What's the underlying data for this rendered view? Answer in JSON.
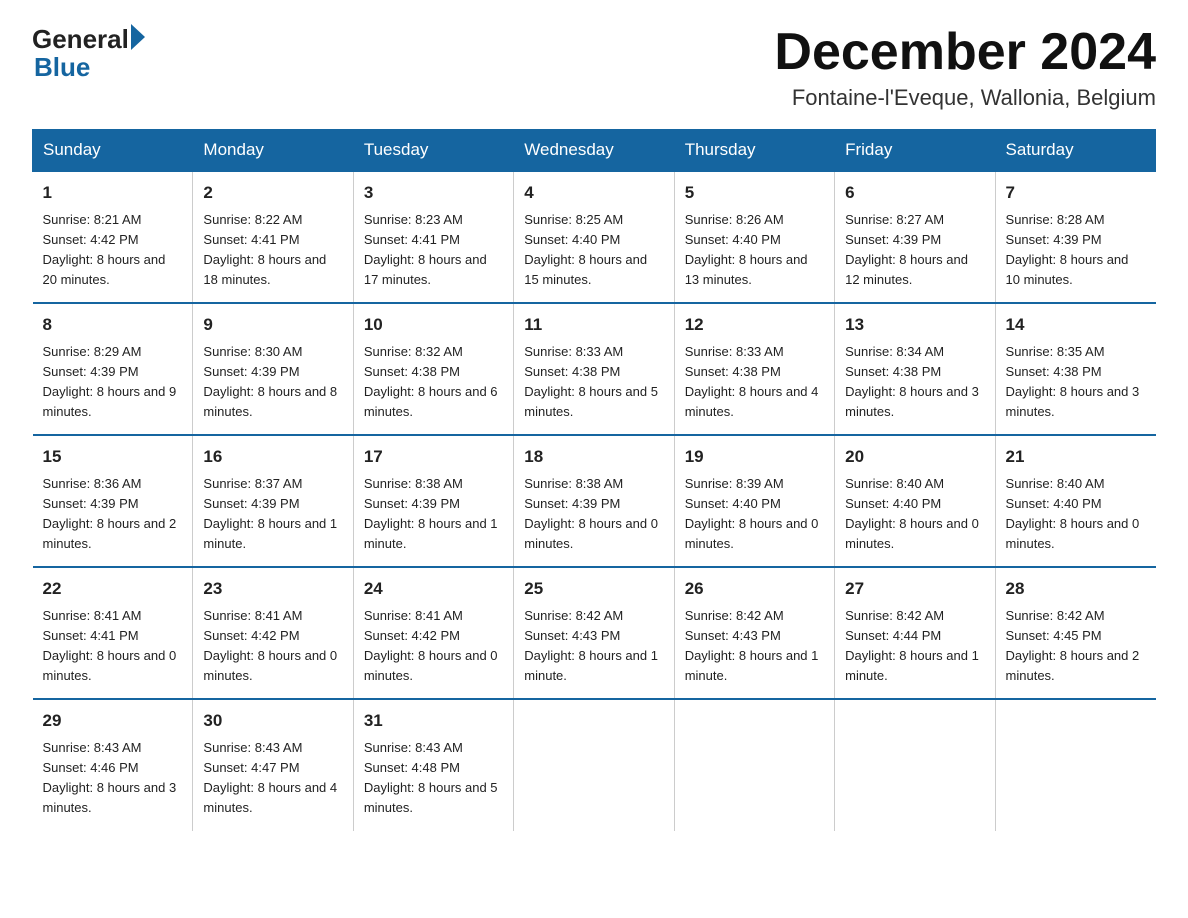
{
  "logo": {
    "general": "General",
    "blue": "Blue"
  },
  "title": "December 2024",
  "location": "Fontaine-l'Eveque, Wallonia, Belgium",
  "weekdays": [
    "Sunday",
    "Monday",
    "Tuesday",
    "Wednesday",
    "Thursday",
    "Friday",
    "Saturday"
  ],
  "weeks": [
    [
      {
        "day": "1",
        "sunrise": "8:21 AM",
        "sunset": "4:42 PM",
        "daylight": "8 hours and 20 minutes."
      },
      {
        "day": "2",
        "sunrise": "8:22 AM",
        "sunset": "4:41 PM",
        "daylight": "8 hours and 18 minutes."
      },
      {
        "day": "3",
        "sunrise": "8:23 AM",
        "sunset": "4:41 PM",
        "daylight": "8 hours and 17 minutes."
      },
      {
        "day": "4",
        "sunrise": "8:25 AM",
        "sunset": "4:40 PM",
        "daylight": "8 hours and 15 minutes."
      },
      {
        "day": "5",
        "sunrise": "8:26 AM",
        "sunset": "4:40 PM",
        "daylight": "8 hours and 13 minutes."
      },
      {
        "day": "6",
        "sunrise": "8:27 AM",
        "sunset": "4:39 PM",
        "daylight": "8 hours and 12 minutes."
      },
      {
        "day": "7",
        "sunrise": "8:28 AM",
        "sunset": "4:39 PM",
        "daylight": "8 hours and 10 minutes."
      }
    ],
    [
      {
        "day": "8",
        "sunrise": "8:29 AM",
        "sunset": "4:39 PM",
        "daylight": "8 hours and 9 minutes."
      },
      {
        "day": "9",
        "sunrise": "8:30 AM",
        "sunset": "4:39 PM",
        "daylight": "8 hours and 8 minutes."
      },
      {
        "day": "10",
        "sunrise": "8:32 AM",
        "sunset": "4:38 PM",
        "daylight": "8 hours and 6 minutes."
      },
      {
        "day": "11",
        "sunrise": "8:33 AM",
        "sunset": "4:38 PM",
        "daylight": "8 hours and 5 minutes."
      },
      {
        "day": "12",
        "sunrise": "8:33 AM",
        "sunset": "4:38 PM",
        "daylight": "8 hours and 4 minutes."
      },
      {
        "day": "13",
        "sunrise": "8:34 AM",
        "sunset": "4:38 PM",
        "daylight": "8 hours and 3 minutes."
      },
      {
        "day": "14",
        "sunrise": "8:35 AM",
        "sunset": "4:38 PM",
        "daylight": "8 hours and 3 minutes."
      }
    ],
    [
      {
        "day": "15",
        "sunrise": "8:36 AM",
        "sunset": "4:39 PM",
        "daylight": "8 hours and 2 minutes."
      },
      {
        "day": "16",
        "sunrise": "8:37 AM",
        "sunset": "4:39 PM",
        "daylight": "8 hours and 1 minute."
      },
      {
        "day": "17",
        "sunrise": "8:38 AM",
        "sunset": "4:39 PM",
        "daylight": "8 hours and 1 minute."
      },
      {
        "day": "18",
        "sunrise": "8:38 AM",
        "sunset": "4:39 PM",
        "daylight": "8 hours and 0 minutes."
      },
      {
        "day": "19",
        "sunrise": "8:39 AM",
        "sunset": "4:40 PM",
        "daylight": "8 hours and 0 minutes."
      },
      {
        "day": "20",
        "sunrise": "8:40 AM",
        "sunset": "4:40 PM",
        "daylight": "8 hours and 0 minutes."
      },
      {
        "day": "21",
        "sunrise": "8:40 AM",
        "sunset": "4:40 PM",
        "daylight": "8 hours and 0 minutes."
      }
    ],
    [
      {
        "day": "22",
        "sunrise": "8:41 AM",
        "sunset": "4:41 PM",
        "daylight": "8 hours and 0 minutes."
      },
      {
        "day": "23",
        "sunrise": "8:41 AM",
        "sunset": "4:42 PM",
        "daylight": "8 hours and 0 minutes."
      },
      {
        "day": "24",
        "sunrise": "8:41 AM",
        "sunset": "4:42 PM",
        "daylight": "8 hours and 0 minutes."
      },
      {
        "day": "25",
        "sunrise": "8:42 AM",
        "sunset": "4:43 PM",
        "daylight": "8 hours and 1 minute."
      },
      {
        "day": "26",
        "sunrise": "8:42 AM",
        "sunset": "4:43 PM",
        "daylight": "8 hours and 1 minute."
      },
      {
        "day": "27",
        "sunrise": "8:42 AM",
        "sunset": "4:44 PM",
        "daylight": "8 hours and 1 minute."
      },
      {
        "day": "28",
        "sunrise": "8:42 AM",
        "sunset": "4:45 PM",
        "daylight": "8 hours and 2 minutes."
      }
    ],
    [
      {
        "day": "29",
        "sunrise": "8:43 AM",
        "sunset": "4:46 PM",
        "daylight": "8 hours and 3 minutes."
      },
      {
        "day": "30",
        "sunrise": "8:43 AM",
        "sunset": "4:47 PM",
        "daylight": "8 hours and 4 minutes."
      },
      {
        "day": "31",
        "sunrise": "8:43 AM",
        "sunset": "4:48 PM",
        "daylight": "8 hours and 5 minutes."
      },
      null,
      null,
      null,
      null
    ]
  ]
}
